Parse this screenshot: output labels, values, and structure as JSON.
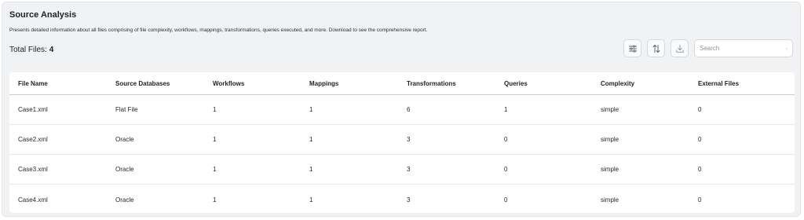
{
  "header": {
    "title": "Source Analysis",
    "description": "Presents detailed information about all files comprising of file complexity, workflows, mappings, transformations, queries executed, and more. Download to see the comprehensive report.",
    "total_label": "Total Files:",
    "total_count": "4"
  },
  "toolbar": {
    "filter_icon": "sliders-icon",
    "sort_icon": "sort-arrows-icon",
    "download_icon": "download-icon",
    "search_placeholder": "Search",
    "search_value": ""
  },
  "table": {
    "columns": [
      "File Name",
      "Source Databases",
      "Workflows",
      "Mappings",
      "Transformations",
      "Queries",
      "Complexity",
      "External Files"
    ],
    "rows": [
      [
        "Case1.xml",
        "Flat File",
        "1",
        "1",
        "6",
        "1",
        "simple",
        "0"
      ],
      [
        "Case2.xml",
        "Oracle",
        "1",
        "1",
        "3",
        "0",
        "simple",
        "0"
      ],
      [
        "Case3.xml",
        "Oracle",
        "1",
        "1",
        "3",
        "0",
        "simple",
        "0"
      ],
      [
        "Case4.xml",
        "Oracle",
        "1",
        "1",
        "3",
        "0",
        "simple",
        "0"
      ]
    ]
  }
}
